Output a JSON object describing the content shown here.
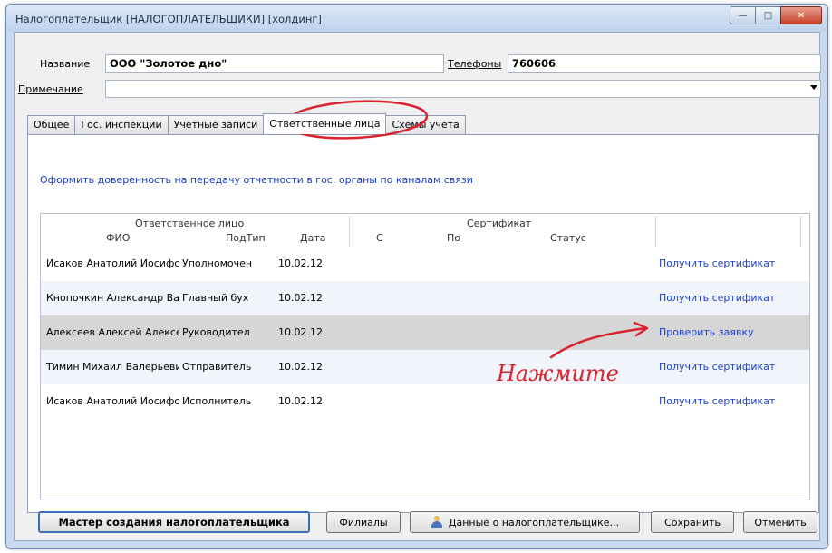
{
  "window": {
    "title": "Налогоплательщик [НАЛОГОПЛАТЕЛЬЩИКИ] [холдинг]",
    "controls": [
      "—",
      "□",
      "✕"
    ]
  },
  "form": {
    "name_label": "Название",
    "name_value": "ООО \"Золотое дно\"",
    "phones_label": "Телефоны",
    "phones_value": "760606",
    "note_label": "Примечание",
    "note_value": ""
  },
  "tabs": [
    {
      "label": "Общее"
    },
    {
      "label": "Гос. инспекции"
    },
    {
      "label": "Учетные записи"
    },
    {
      "label": "Ответственные лица"
    },
    {
      "label": "Схемы учета"
    }
  ],
  "proxy_link": "Оформить доверенность на передачу отчетности в гос. органы по каналам связи",
  "grid": {
    "group_responsible": "Ответственное лицо",
    "group_certificate": "Сертификат",
    "columns": {
      "fio": "ФИО",
      "subtype": "ПодТип",
      "date": "Дата",
      "from": "С",
      "to": "По",
      "status": "Статус"
    },
    "rows": [
      {
        "fio": "Исаков Анатолий Иосифовь",
        "subtype": "Уполномочен",
        "date": "10.02.12",
        "action": "Получить сертификат"
      },
      {
        "fio": "Кнопочкин Александр Васи",
        "subtype": "Главный бух",
        "date": "10.02.12",
        "action": "Получить сертификат"
      },
      {
        "fio": "Алексеев Алексей Алексее",
        "subtype": "Руководител",
        "date": "10.02.12",
        "action": "Проверить заявку"
      },
      {
        "fio": "Тимин Михаил Валерьевич",
        "subtype": "Отправитель",
        "date": "10.02.12",
        "action": "Получить сертификат"
      },
      {
        "fio": "Исаков Анатолий Иосифовь",
        "subtype": "Исполнитель",
        "date": "10.02.12",
        "action": "Получить сертификат"
      }
    ]
  },
  "annotation": {
    "text": "Нажмите",
    "color": "#d9232e"
  },
  "buttons": {
    "wizard": "Мастер создания налогоплательщика",
    "branches": "Филиалы",
    "taxpayer_data": "Данные о налогоплательщике...",
    "save": "Сохранить",
    "cancel": "Отменить"
  }
}
